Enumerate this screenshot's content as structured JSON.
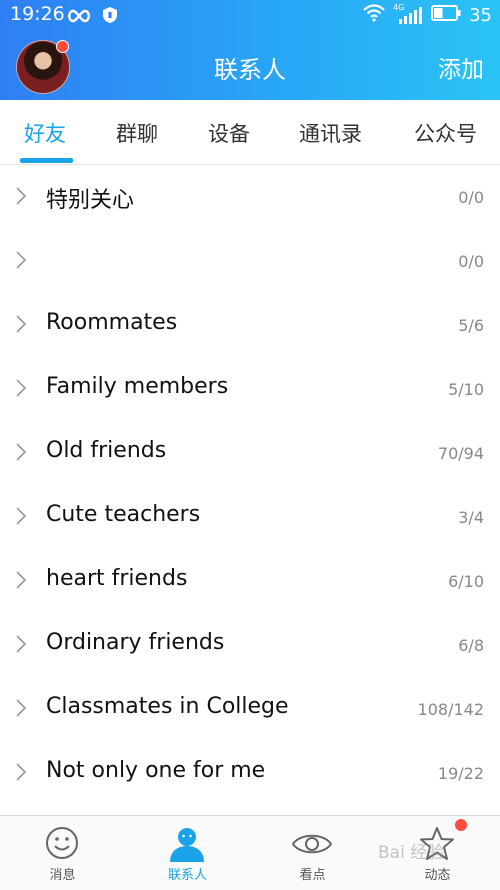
{
  "status_bar": {
    "time": "19:26",
    "network": "4G",
    "battery": "35"
  },
  "header": {
    "title": "联系人",
    "action": "添加"
  },
  "tabs": [
    {
      "label": "好友",
      "active": true
    },
    {
      "label": "群聊"
    },
    {
      "label": "设备"
    },
    {
      "label": "通讯录"
    },
    {
      "label": "公众号"
    }
  ],
  "groups": [
    {
      "name": "特别关心",
      "count": "0/0"
    },
    {
      "name": "",
      "count": "0/0"
    },
    {
      "name": "Roommates",
      "count": "5/6"
    },
    {
      "name": "Family members",
      "count": "5/10"
    },
    {
      "name": "Old friends",
      "count": "70/94"
    },
    {
      "name": "Cute teachers",
      "count": "3/4"
    },
    {
      "name": "heart friends",
      "count": "6/10"
    },
    {
      "name": "Ordinary friends",
      "count": "6/8"
    },
    {
      "name": "Classmates in College",
      "count": "108/142"
    },
    {
      "name": "Not only one for me",
      "count": "19/22"
    }
  ],
  "bottom_nav": [
    {
      "label": "消息",
      "icon": "smiley-icon"
    },
    {
      "label": "联系人",
      "icon": "contacts-person-icon",
      "active": true
    },
    {
      "label": "看点",
      "icon": "eye-icon"
    },
    {
      "label": "动态",
      "icon": "star-icon",
      "badge": true
    }
  ],
  "watermark": "Bai 经验",
  "colors": {
    "accent": "#1aa3e8",
    "header_start": "#2f7ff4",
    "header_end": "#2bc3f5",
    "badge": "#ff4b3c"
  }
}
